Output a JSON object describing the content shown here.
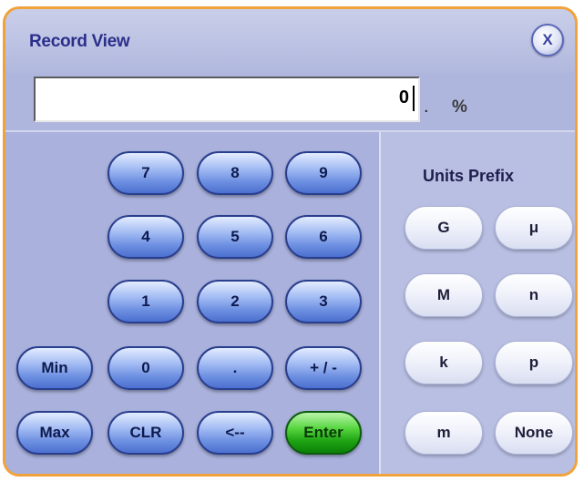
{
  "window": {
    "title": "Record View",
    "close_label": "X"
  },
  "display": {
    "value": "0",
    "dot": ".",
    "unit": "%"
  },
  "keypad": {
    "k7": "7",
    "k8": "8",
    "k9": "9",
    "k4": "4",
    "k5": "5",
    "k6": "6",
    "k1": "1",
    "k2": "2",
    "k3": "3",
    "min": "Min",
    "k0": "0",
    "dot": ".",
    "sign": "+ / -",
    "max": "Max",
    "clr": "CLR",
    "back": "<--",
    "enter": "Enter"
  },
  "units_prefix": {
    "title": "Units Prefix",
    "giga": "G",
    "micro": "μ",
    "mega": "M",
    "nano": "n",
    "kilo": "k",
    "pico": "p",
    "milli": "m",
    "none": "None"
  },
  "colors": {
    "border": "#f2a23a",
    "title": "#2c2f8a",
    "key_blue": "#6f91e2",
    "key_green": "#1ea414"
  }
}
